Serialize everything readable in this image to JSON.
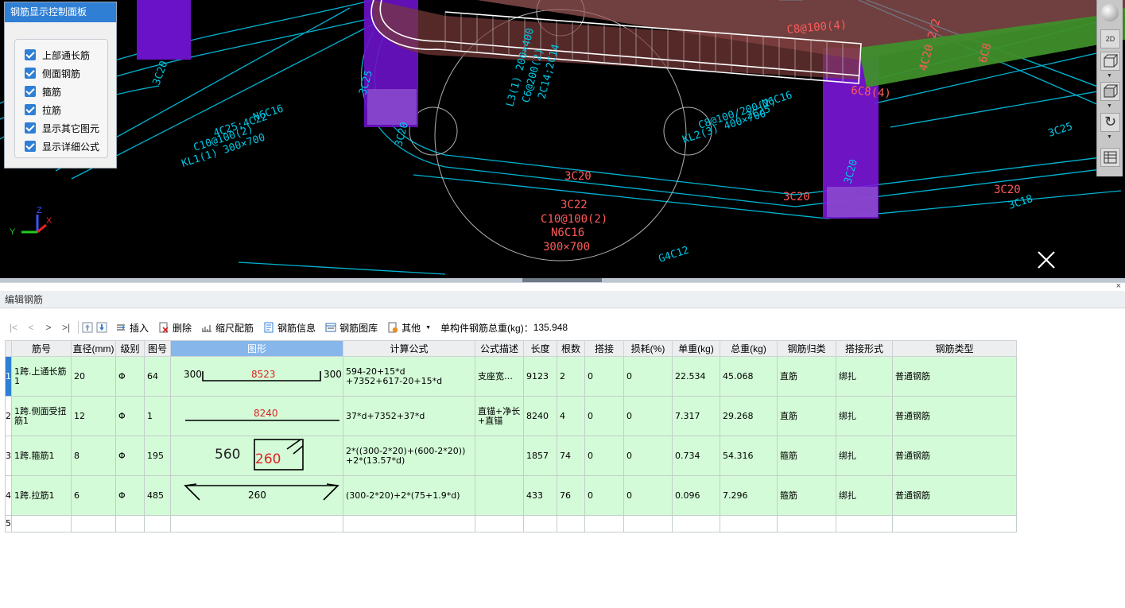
{
  "control_panel": {
    "title": "钢筋显示控制面板",
    "items": [
      {
        "label": "上部通长筋",
        "checked": true
      },
      {
        "label": "侧面钢筋",
        "checked": true
      },
      {
        "label": "箍筋",
        "checked": true
      },
      {
        "label": "拉筋",
        "checked": true
      },
      {
        "label": "显示其它图元",
        "checked": true
      },
      {
        "label": "显示详细公式",
        "checked": true
      }
    ]
  },
  "viewport": {
    "labels_cyan": [
      "KL1(1) 300×700",
      "C10@100(2)",
      "4C25;4C22",
      "N6C16",
      "3C20",
      "3C25",
      "3C20",
      "KL2(3) 400×700",
      "C8@100/200(2)",
      "2C25",
      "N6C16",
      "3C20",
      "3C25",
      "3C18",
      "L3(1) 200×400",
      "C6@200(2)",
      "2C14;2C14",
      "G4C12"
    ],
    "labels_red": [
      "3C20",
      "3C22",
      "C10@100(2)",
      "N6C16",
      "300×700",
      "3C20",
      "3C20",
      "3C18",
      "C8@100(4)",
      "4C20 2/2",
      "6C8",
      "6C8(4)",
      "3C25"
    ],
    "axis": {
      "x": "X",
      "y": "Y",
      "z": "Z"
    },
    "right_tools": [
      "sphere-icon",
      "2D",
      "cube-front-icon",
      "cube-iso-icon",
      "rotate-icon",
      "table-icon"
    ]
  },
  "editor": {
    "title": "编辑钢筋",
    "toolbar": {
      "nav": [
        "|<",
        "<",
        ">",
        ">|"
      ],
      "insert": "插入",
      "delete": "删除",
      "scale": "缩尺配筋",
      "info": "钢筋信息",
      "library": "钢筋图库",
      "other": "其他",
      "total_label": "单构件钢筋总重(kg)：",
      "total_value": "135.948"
    },
    "columns": [
      "筋号",
      "直径(mm)",
      "级别",
      "图号",
      "图形",
      "计算公式",
      "公式描述",
      "长度",
      "根数",
      "搭接",
      "损耗(%)",
      "单重(kg)",
      "总重(kg)",
      "钢筋归类",
      "搭接形式",
      "钢筋类型"
    ],
    "rows": [
      {
        "num": "1",
        "name": "1跨.上通长筋1",
        "dia": "20",
        "grade": "Φ",
        "fig": "64",
        "shape": {
          "left": "300",
          "mid": "8523",
          "right": "300"
        },
        "formula": "594-20+15*d\n+7352+617-20+15*d",
        "desc": "支座宽…",
        "length": "9123",
        "count": "2",
        "lap": "0",
        "loss": "0",
        "unit_w": "22.534",
        "total_w": "45.068",
        "category": "直筋",
        "lap_type": "绑扎",
        "type": "普通钢筋"
      },
      {
        "num": "2",
        "name": "1跨.侧面受扭筋1",
        "dia": "12",
        "grade": "Φ",
        "fig": "1",
        "shape": {
          "mid": "8240"
        },
        "formula": "37*d+7352+37*d",
        "desc": "直锚+净长\n+直锚",
        "length": "8240",
        "count": "4",
        "lap": "0",
        "loss": "0",
        "unit_w": "7.317",
        "total_w": "29.268",
        "category": "直筋",
        "lap_type": "绑扎",
        "type": "普通钢筋"
      },
      {
        "num": "3",
        "name": "1跨.箍筋1",
        "dia": "8",
        "grade": "Φ",
        "fig": "195",
        "shape": {
          "left": "560",
          "mid": "260"
        },
        "formula": "2*((300-2*20)+(600-2*20))\n+2*(13.57*d)",
        "desc": "",
        "length": "1857",
        "count": "74",
        "lap": "0",
        "loss": "0",
        "unit_w": "0.734",
        "total_w": "54.316",
        "category": "箍筋",
        "lap_type": "绑扎",
        "type": "普通钢筋"
      },
      {
        "num": "4",
        "name": "1跨.拉筋1",
        "dia": "6",
        "grade": "Φ",
        "fig": "485",
        "shape": {
          "mid": "260"
        },
        "formula": "(300-2*20)+2*(75+1.9*d)",
        "desc": "",
        "length": "433",
        "count": "76",
        "lap": "0",
        "loss": "0",
        "unit_w": "0.096",
        "total_w": "7.296",
        "category": "箍筋",
        "lap_type": "绑扎",
        "type": "普通钢筋"
      }
    ],
    "empty_row_num": "5"
  }
}
